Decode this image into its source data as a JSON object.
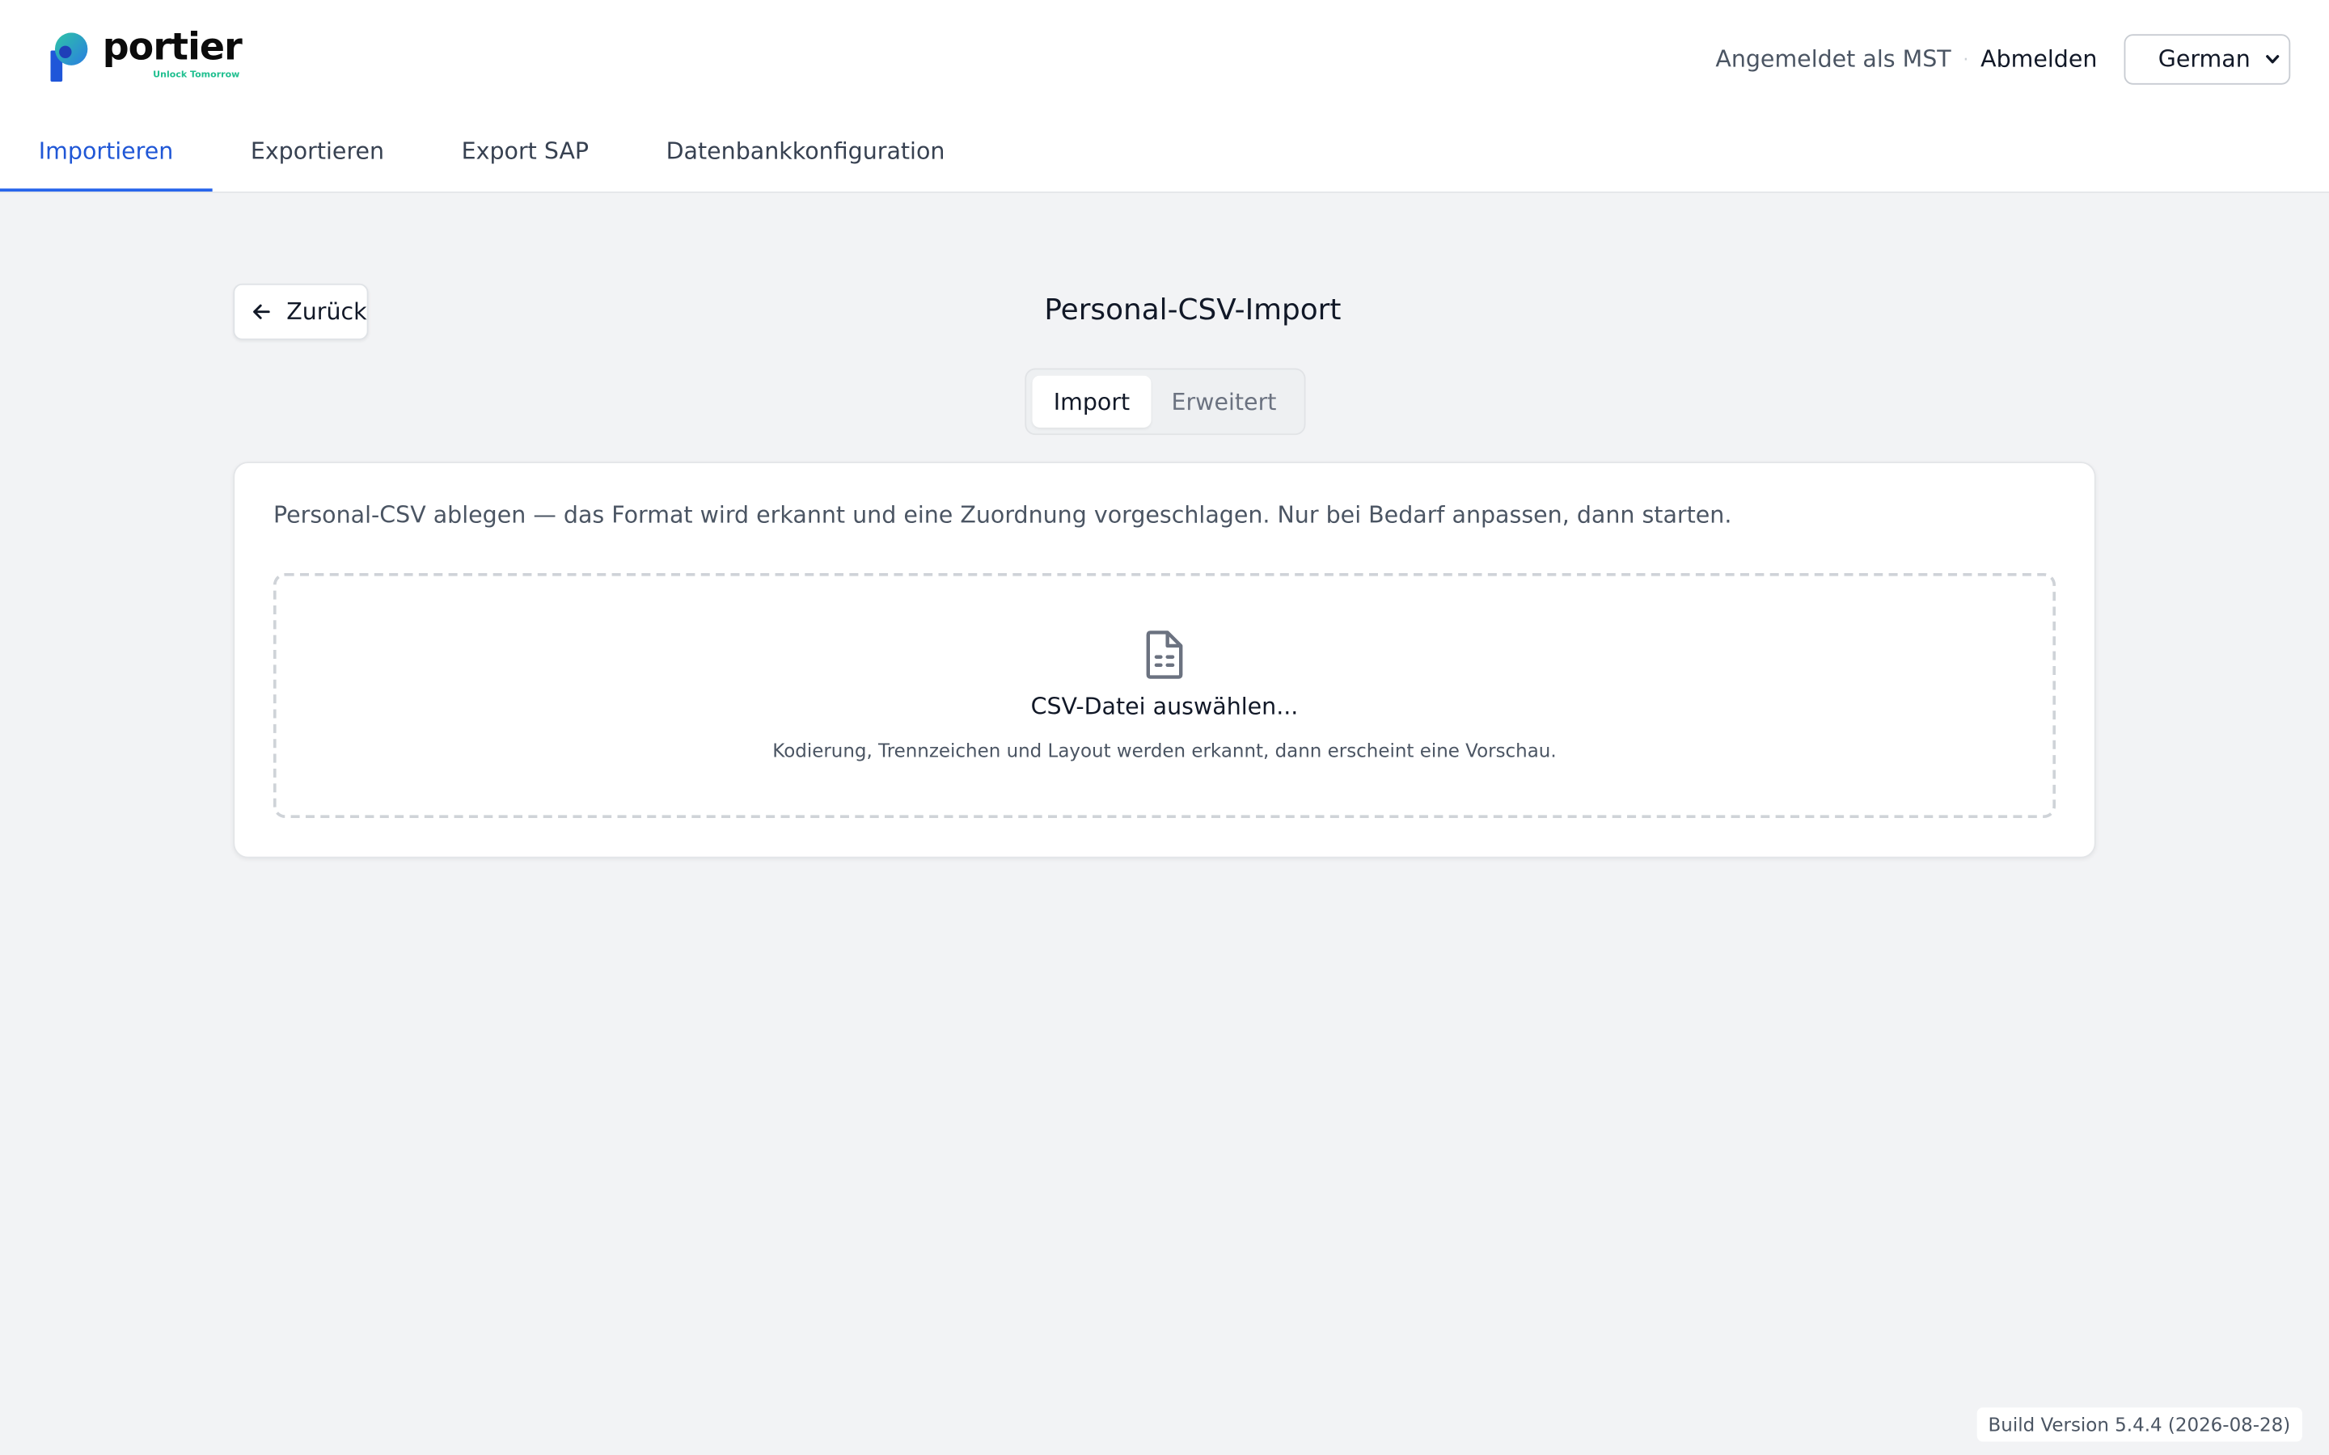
{
  "brand": {
    "name": "portier",
    "tagline": "Unlock Tomorrow",
    "accent_color": "#2563eb",
    "tagline_color": "#1fbf8f"
  },
  "header": {
    "user_label": "Angemeldet als MST",
    "separator": "·",
    "logout_label": "Abmelden",
    "language": {
      "selected": "German",
      "icon": "chevron-down-icon"
    }
  },
  "nav": {
    "tabs": [
      {
        "label": "Importieren",
        "active": true
      },
      {
        "label": "Exportieren",
        "active": false
      },
      {
        "label": "Export SAP",
        "active": false
      },
      {
        "label": "Datenbankkonfiguration",
        "active": false
      }
    ]
  },
  "page": {
    "back_label": "Zurück",
    "back_icon": "arrow-left-icon",
    "title": "Personal-CSV-Import",
    "mode_tabs": [
      {
        "label": "Import",
        "active": true
      },
      {
        "label": "Erweitert",
        "active": false
      }
    ]
  },
  "card": {
    "description": "Personal-CSV ablegen — das Format wird erkannt und eine Zuordnung vorgeschlagen. Nur bei Bedarf anpassen, dann starten.",
    "dropzone": {
      "icon": "file-text-icon",
      "title": "CSV-Datei auswählen...",
      "subtitle": "Kodierung, Trennzeichen und Layout werden erkannt, dann erscheint eine Vorschau."
    }
  },
  "footer": {
    "build_version": "Build Version 5.4.4 (2026-08-28)"
  }
}
